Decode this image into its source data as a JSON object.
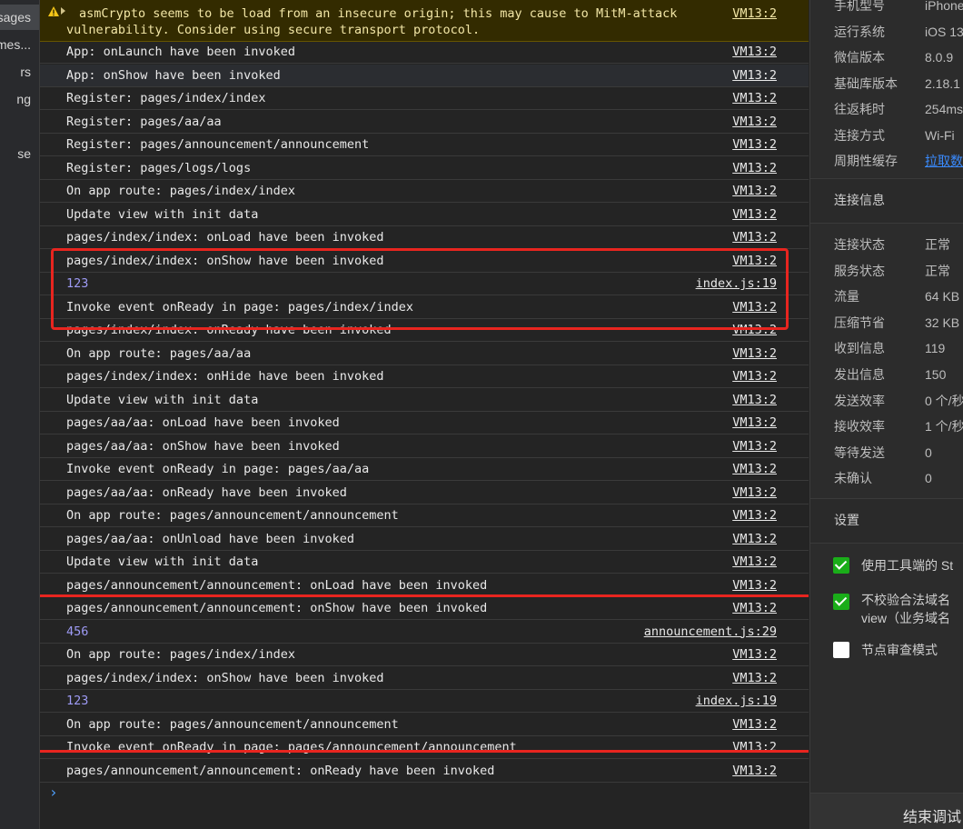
{
  "nav": {
    "items": [
      {
        "label": "sages"
      },
      {
        "label": "mes..."
      },
      {
        "label": "rs"
      },
      {
        "label": "ng"
      },
      {
        "label": "se"
      }
    ]
  },
  "console": {
    "warning": {
      "line1": "asmCrypto seems to be load from an insecure origin; this may cause to MitM-attack",
      "line2": "vulnerability. Consider using secure transport protocol.",
      "source": "VM13:2"
    },
    "rows": [
      {
        "msg": "App: onLaunch have been invoked",
        "src": "VM13:2"
      },
      {
        "msg": "App: onShow have been invoked",
        "src": "VM13:2"
      },
      {
        "msg": "Register: pages/index/index",
        "src": "VM13:2"
      },
      {
        "msg": "Register: pages/aa/aa",
        "src": "VM13:2"
      },
      {
        "msg": "Register: pages/announcement/announcement",
        "src": "VM13:2"
      },
      {
        "msg": "Register: pages/logs/logs",
        "src": "VM13:2"
      },
      {
        "msg": "On app route: pages/index/index",
        "src": "VM13:2"
      },
      {
        "msg": "Update view with init data",
        "src": "VM13:2"
      },
      {
        "msg": "pages/index/index: onLoad have been invoked",
        "src": "VM13:2"
      },
      {
        "msg": "pages/index/index: onShow have been invoked",
        "src": "VM13:2"
      },
      {
        "msg": "123",
        "src": "index.js:19"
      },
      {
        "msg": "Invoke event onReady in page: pages/index/index",
        "src": "VM13:2"
      },
      {
        "msg": "pages/index/index: onReady have been invoked",
        "src": "VM13:2"
      },
      {
        "msg": "On app route: pages/aa/aa",
        "src": "VM13:2"
      },
      {
        "msg": "pages/index/index: onHide have been invoked",
        "src": "VM13:2"
      },
      {
        "msg": "Update view with init data",
        "src": "VM13:2"
      },
      {
        "msg": "pages/aa/aa: onLoad have been invoked",
        "src": "VM13:2"
      },
      {
        "msg": "pages/aa/aa: onShow have been invoked",
        "src": "VM13:2"
      },
      {
        "msg": "Invoke event onReady in page: pages/aa/aa",
        "src": "VM13:2"
      },
      {
        "msg": "pages/aa/aa: onReady have been invoked",
        "src": "VM13:2"
      },
      {
        "msg": "On app route: pages/announcement/announcement",
        "src": "VM13:2"
      },
      {
        "msg": "pages/aa/aa: onUnload have been invoked",
        "src": "VM13:2"
      },
      {
        "msg": "Update view with init data",
        "src": "VM13:2"
      },
      {
        "msg": "pages/announcement/announcement: onLoad have been invoked",
        "src": "VM13:2"
      },
      {
        "msg": "pages/announcement/announcement: onShow have been invoked",
        "src": "VM13:2"
      },
      {
        "msg": "456",
        "src": "announcement.js:29"
      },
      {
        "msg": "On app route: pages/index/index",
        "src": "VM13:2"
      },
      {
        "msg": "pages/index/index: onShow have been invoked",
        "src": "VM13:2"
      },
      {
        "msg": "123",
        "src": "index.js:19"
      },
      {
        "msg": "On app route: pages/announcement/announcement",
        "src": "VM13:2"
      },
      {
        "msg": "Invoke event onReady in page: pages/announcement/announcement",
        "src": "VM13:2"
      },
      {
        "msg": "pages/announcement/announcement: onReady have been invoked",
        "src": "VM13:2"
      }
    ],
    "prompt": "›"
  },
  "panel": {
    "device": [
      {
        "k": "手机型号",
        "v": "iPhone"
      },
      {
        "k": "运行系统",
        "v": "iOS 13"
      },
      {
        "k": "微信版本",
        "v": "8.0.9"
      },
      {
        "k": "基础库版本",
        "v": "2.18.1"
      },
      {
        "k": "往返耗时",
        "v": "254ms"
      },
      {
        "k": "连接方式",
        "v": "Wi-Fi"
      },
      {
        "k": "周期性缓存",
        "v": "拉取数"
      }
    ],
    "conn_title": "连接信息",
    "conn": [
      {
        "k": "连接状态",
        "v": "正常"
      },
      {
        "k": "服务状态",
        "v": "正常"
      },
      {
        "k": "流量",
        "v": "64 KB"
      },
      {
        "k": "压缩节省",
        "v": "32 KB"
      },
      {
        "k": "收到信息",
        "v": "119"
      },
      {
        "k": "发出信息",
        "v": "150"
      },
      {
        "k": "发送效率",
        "v": "0 个/秒"
      },
      {
        "k": "接收效率",
        "v": "1 个/秒"
      },
      {
        "k": "等待发送",
        "v": "0"
      },
      {
        "k": "未确认",
        "v": "0"
      }
    ],
    "settings_title": "设置",
    "settings": [
      {
        "label": "使用工具端的 St",
        "checked": true
      },
      {
        "label": "不校验合法域名",
        "label2": "view（业务域名",
        "checked": true
      },
      {
        "label": "节点审查模式",
        "checked": false
      }
    ],
    "end_button": "结束调试"
  },
  "colors": {
    "highlight_box": "#e8251f",
    "number_log": "#9e9bf5",
    "checkbox_on": "#1aad19",
    "link": "#3a8bff"
  }
}
